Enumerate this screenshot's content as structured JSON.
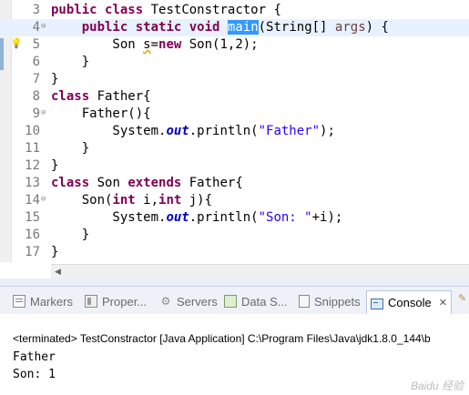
{
  "editor": {
    "lines": [
      {
        "num": "3",
        "fold": false,
        "tokens": [
          {
            "t": "kw",
            "v": "public"
          },
          {
            "t": "",
            "v": " "
          },
          {
            "t": "kw",
            "v": "class"
          },
          {
            "t": "",
            "v": " TestConstractor {"
          }
        ]
      },
      {
        "num": "4",
        "fold": true,
        "current": true,
        "tokens": [
          {
            "t": "",
            "v": "    "
          },
          {
            "t": "kw",
            "v": "public"
          },
          {
            "t": "",
            "v": " "
          },
          {
            "t": "kw",
            "v": "static"
          },
          {
            "t": "",
            "v": " "
          },
          {
            "t": "kw",
            "v": "void"
          },
          {
            "t": "",
            "v": " "
          },
          {
            "t": "hl",
            "v": "main"
          },
          {
            "t": "",
            "v": "(String[] "
          },
          {
            "t": "param",
            "v": "args"
          },
          {
            "t": "",
            "v": ") {"
          }
        ]
      },
      {
        "num": "5",
        "fold": false,
        "tokens": [
          {
            "t": "",
            "v": "        Son "
          },
          {
            "t": "warn",
            "v": "s"
          },
          {
            "t": "",
            "v": "="
          },
          {
            "t": "kw",
            "v": "new"
          },
          {
            "t": "",
            "v": " Son(1,2);"
          }
        ]
      },
      {
        "num": "6",
        "fold": false,
        "tokens": [
          {
            "t": "",
            "v": "    }"
          }
        ]
      },
      {
        "num": "7",
        "fold": false,
        "tokens": [
          {
            "t": "",
            "v": "}"
          }
        ]
      },
      {
        "num": "8",
        "fold": false,
        "tokens": [
          {
            "t": "kw",
            "v": "class"
          },
          {
            "t": "",
            "v": " Father{"
          }
        ]
      },
      {
        "num": "9",
        "fold": true,
        "tokens": [
          {
            "t": "",
            "v": "    Father(){"
          }
        ]
      },
      {
        "num": "10",
        "fold": false,
        "tokens": [
          {
            "t": "",
            "v": "        System."
          },
          {
            "t": "fld",
            "v": "out"
          },
          {
            "t": "",
            "v": ".println("
          },
          {
            "t": "str",
            "v": "\"Father\""
          },
          {
            "t": "",
            "v": ");"
          }
        ]
      },
      {
        "num": "11",
        "fold": false,
        "tokens": [
          {
            "t": "",
            "v": "    }"
          }
        ]
      },
      {
        "num": "12",
        "fold": false,
        "tokens": [
          {
            "t": "",
            "v": "}"
          }
        ]
      },
      {
        "num": "13",
        "fold": false,
        "tokens": [
          {
            "t": "kw",
            "v": "class"
          },
          {
            "t": "",
            "v": " Son "
          },
          {
            "t": "kw",
            "v": "extends"
          },
          {
            "t": "",
            "v": " Father{"
          }
        ]
      },
      {
        "num": "14",
        "fold": true,
        "tokens": [
          {
            "t": "",
            "v": "    Son("
          },
          {
            "t": "kw",
            "v": "int"
          },
          {
            "t": "",
            "v": " i,"
          },
          {
            "t": "kw",
            "v": "int"
          },
          {
            "t": "",
            "v": " j){"
          }
        ]
      },
      {
        "num": "15",
        "fold": false,
        "tokens": [
          {
            "t": "",
            "v": "        System."
          },
          {
            "t": "fld",
            "v": "out"
          },
          {
            "t": "",
            "v": ".println("
          },
          {
            "t": "str",
            "v": "\"Son: \""
          },
          {
            "t": "",
            "v": "+i);"
          }
        ]
      },
      {
        "num": "16",
        "fold": false,
        "tokens": [
          {
            "t": "",
            "v": "    }"
          }
        ]
      },
      {
        "num": "17",
        "fold": false,
        "tokens": [
          {
            "t": "",
            "v": "}"
          }
        ]
      }
    ],
    "fold_glyph": "⊖",
    "quickfix_glyph": "💡",
    "scroll_left_glyph": "◀"
  },
  "views": {
    "tabs": [
      {
        "id": "markers",
        "label": "Markers",
        "icon": "markers-icon",
        "active": false
      },
      {
        "id": "properties",
        "label": "Proper...",
        "icon": "properties-icon",
        "active": false
      },
      {
        "id": "servers",
        "label": "Servers",
        "icon": "servers-icon",
        "active": false
      },
      {
        "id": "datasource",
        "label": "Data S...",
        "icon": "data-source-icon",
        "active": false
      },
      {
        "id": "snippets",
        "label": "Snippets",
        "icon": "snippets-icon",
        "active": false
      },
      {
        "id": "console",
        "label": "Console",
        "icon": "console-icon",
        "active": true,
        "close": "✕"
      }
    ],
    "servers_glyph": "⚙",
    "pin_glyph": "✎"
  },
  "console": {
    "header": "<terminated> TestConstractor [Java Application] C:\\Program Files\\Java\\jdk1.8.0_144\\b",
    "output": [
      "Father",
      "Son: 1"
    ]
  },
  "watermark": "Baidu 经验"
}
